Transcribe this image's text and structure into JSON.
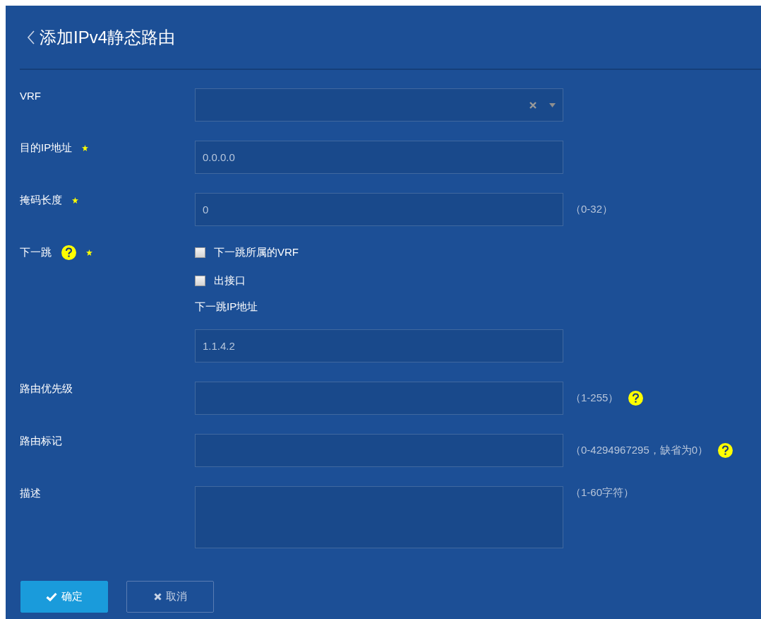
{
  "title": "添加IPv4静态路由",
  "fields": [
    {
      "kind": "select",
      "label": "VRF",
      "required": false,
      "help": false
    },
    {
      "kind": "text",
      "label": "目的IP地址",
      "required": true,
      "help": false,
      "value": "0.0.0.0"
    },
    {
      "kind": "text",
      "label": "掩码长度",
      "required": true,
      "help": false,
      "value": "0",
      "hint": "（0-32）",
      "hint_help": false
    },
    {
      "kind": "nexthop",
      "label": "下一跳",
      "required": true,
      "help": true,
      "options": [
        {
          "label": "下一跳所属的VRF",
          "checked": false
        },
        {
          "label": "出接口",
          "checked": false
        }
      ],
      "sublabel": "下一跳IP地址",
      "value": "1.1.4.2"
    },
    {
      "kind": "text",
      "label": "路由优先级",
      "required": false,
      "help": false,
      "hint": "（1-255）",
      "hint_help": true
    },
    {
      "kind": "text",
      "label": "路由标记",
      "required": false,
      "help": false,
      "hint": "（0-4294967295，缺省为0）",
      "hint_help": true
    },
    {
      "kind": "textarea",
      "label": "描述",
      "required": false,
      "help": false,
      "hint": "（1-60字符）",
      "hint_help": false
    }
  ],
  "buttons": [
    {
      "label": "确定",
      "kind": "primary"
    },
    {
      "label": "取消",
      "kind": "secondary"
    }
  ]
}
